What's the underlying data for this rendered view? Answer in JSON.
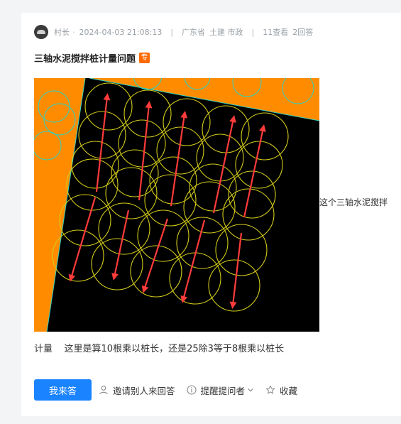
{
  "post": {
    "author": "村长",
    "datetime": "2024-04-03 21:08:13",
    "separator": "|",
    "region": "广东省",
    "categories": "土建 市政",
    "views": "11查看",
    "answers": "2回答",
    "title": "三轴水泥搅拌桩计量问题",
    "tag": "专",
    "inline_caption": "这个三轴水泥搅拌",
    "body_line": "计量    这里是算10根乘以桩长，还是25除3等于8根乘以桩长"
  },
  "actions": {
    "answer_label": "我来答",
    "invite_label": "邀请别人来回答",
    "remind_label": "提醒提问者",
    "collect_label": "收藏"
  },
  "colors": {
    "accent": "#1a83ff",
    "tag": "#ff6a00",
    "figure_orange": "#ff8c00",
    "pile_yellow": "#d4cc1a",
    "arrow_red": "#ff3b3b",
    "border_cyan": "#2fd3c0"
  },
  "icons": {
    "avatar": "avatar",
    "invite": "person-icon",
    "remind": "info-icon",
    "dropdown": "chevron-down-icon",
    "collect": "star-icon"
  }
}
